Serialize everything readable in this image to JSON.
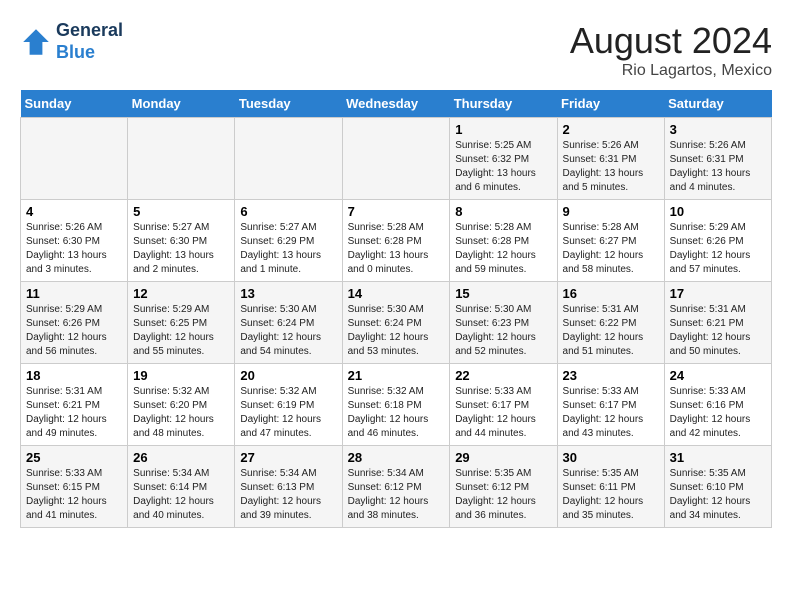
{
  "header": {
    "logo_line1": "General",
    "logo_line2": "Blue",
    "title": "August 2024",
    "subtitle": "Rio Lagartos, Mexico"
  },
  "days_of_week": [
    "Sunday",
    "Monday",
    "Tuesday",
    "Wednesday",
    "Thursday",
    "Friday",
    "Saturday"
  ],
  "weeks": [
    [
      {
        "day": "",
        "info": ""
      },
      {
        "day": "",
        "info": ""
      },
      {
        "day": "",
        "info": ""
      },
      {
        "day": "",
        "info": ""
      },
      {
        "day": "1",
        "info": "Sunrise: 5:25 AM\nSunset: 6:32 PM\nDaylight: 13 hours\nand 6 minutes."
      },
      {
        "day": "2",
        "info": "Sunrise: 5:26 AM\nSunset: 6:31 PM\nDaylight: 13 hours\nand 5 minutes."
      },
      {
        "day": "3",
        "info": "Sunrise: 5:26 AM\nSunset: 6:31 PM\nDaylight: 13 hours\nand 4 minutes."
      }
    ],
    [
      {
        "day": "4",
        "info": "Sunrise: 5:26 AM\nSunset: 6:30 PM\nDaylight: 13 hours\nand 3 minutes."
      },
      {
        "day": "5",
        "info": "Sunrise: 5:27 AM\nSunset: 6:30 PM\nDaylight: 13 hours\nand 2 minutes."
      },
      {
        "day": "6",
        "info": "Sunrise: 5:27 AM\nSunset: 6:29 PM\nDaylight: 13 hours\nand 1 minute."
      },
      {
        "day": "7",
        "info": "Sunrise: 5:28 AM\nSunset: 6:28 PM\nDaylight: 13 hours\nand 0 minutes."
      },
      {
        "day": "8",
        "info": "Sunrise: 5:28 AM\nSunset: 6:28 PM\nDaylight: 12 hours\nand 59 minutes."
      },
      {
        "day": "9",
        "info": "Sunrise: 5:28 AM\nSunset: 6:27 PM\nDaylight: 12 hours\nand 58 minutes."
      },
      {
        "day": "10",
        "info": "Sunrise: 5:29 AM\nSunset: 6:26 PM\nDaylight: 12 hours\nand 57 minutes."
      }
    ],
    [
      {
        "day": "11",
        "info": "Sunrise: 5:29 AM\nSunset: 6:26 PM\nDaylight: 12 hours\nand 56 minutes."
      },
      {
        "day": "12",
        "info": "Sunrise: 5:29 AM\nSunset: 6:25 PM\nDaylight: 12 hours\nand 55 minutes."
      },
      {
        "day": "13",
        "info": "Sunrise: 5:30 AM\nSunset: 6:24 PM\nDaylight: 12 hours\nand 54 minutes."
      },
      {
        "day": "14",
        "info": "Sunrise: 5:30 AM\nSunset: 6:24 PM\nDaylight: 12 hours\nand 53 minutes."
      },
      {
        "day": "15",
        "info": "Sunrise: 5:30 AM\nSunset: 6:23 PM\nDaylight: 12 hours\nand 52 minutes."
      },
      {
        "day": "16",
        "info": "Sunrise: 5:31 AM\nSunset: 6:22 PM\nDaylight: 12 hours\nand 51 minutes."
      },
      {
        "day": "17",
        "info": "Sunrise: 5:31 AM\nSunset: 6:21 PM\nDaylight: 12 hours\nand 50 minutes."
      }
    ],
    [
      {
        "day": "18",
        "info": "Sunrise: 5:31 AM\nSunset: 6:21 PM\nDaylight: 12 hours\nand 49 minutes."
      },
      {
        "day": "19",
        "info": "Sunrise: 5:32 AM\nSunset: 6:20 PM\nDaylight: 12 hours\nand 48 minutes."
      },
      {
        "day": "20",
        "info": "Sunrise: 5:32 AM\nSunset: 6:19 PM\nDaylight: 12 hours\nand 47 minutes."
      },
      {
        "day": "21",
        "info": "Sunrise: 5:32 AM\nSunset: 6:18 PM\nDaylight: 12 hours\nand 46 minutes."
      },
      {
        "day": "22",
        "info": "Sunrise: 5:33 AM\nSunset: 6:17 PM\nDaylight: 12 hours\nand 44 minutes."
      },
      {
        "day": "23",
        "info": "Sunrise: 5:33 AM\nSunset: 6:17 PM\nDaylight: 12 hours\nand 43 minutes."
      },
      {
        "day": "24",
        "info": "Sunrise: 5:33 AM\nSunset: 6:16 PM\nDaylight: 12 hours\nand 42 minutes."
      }
    ],
    [
      {
        "day": "25",
        "info": "Sunrise: 5:33 AM\nSunset: 6:15 PM\nDaylight: 12 hours\nand 41 minutes."
      },
      {
        "day": "26",
        "info": "Sunrise: 5:34 AM\nSunset: 6:14 PM\nDaylight: 12 hours\nand 40 minutes."
      },
      {
        "day": "27",
        "info": "Sunrise: 5:34 AM\nSunset: 6:13 PM\nDaylight: 12 hours\nand 39 minutes."
      },
      {
        "day": "28",
        "info": "Sunrise: 5:34 AM\nSunset: 6:12 PM\nDaylight: 12 hours\nand 38 minutes."
      },
      {
        "day": "29",
        "info": "Sunrise: 5:35 AM\nSunset: 6:12 PM\nDaylight: 12 hours\nand 36 minutes."
      },
      {
        "day": "30",
        "info": "Sunrise: 5:35 AM\nSunset: 6:11 PM\nDaylight: 12 hours\nand 35 minutes."
      },
      {
        "day": "31",
        "info": "Sunrise: 5:35 AM\nSunset: 6:10 PM\nDaylight: 12 hours\nand 34 minutes."
      }
    ]
  ]
}
